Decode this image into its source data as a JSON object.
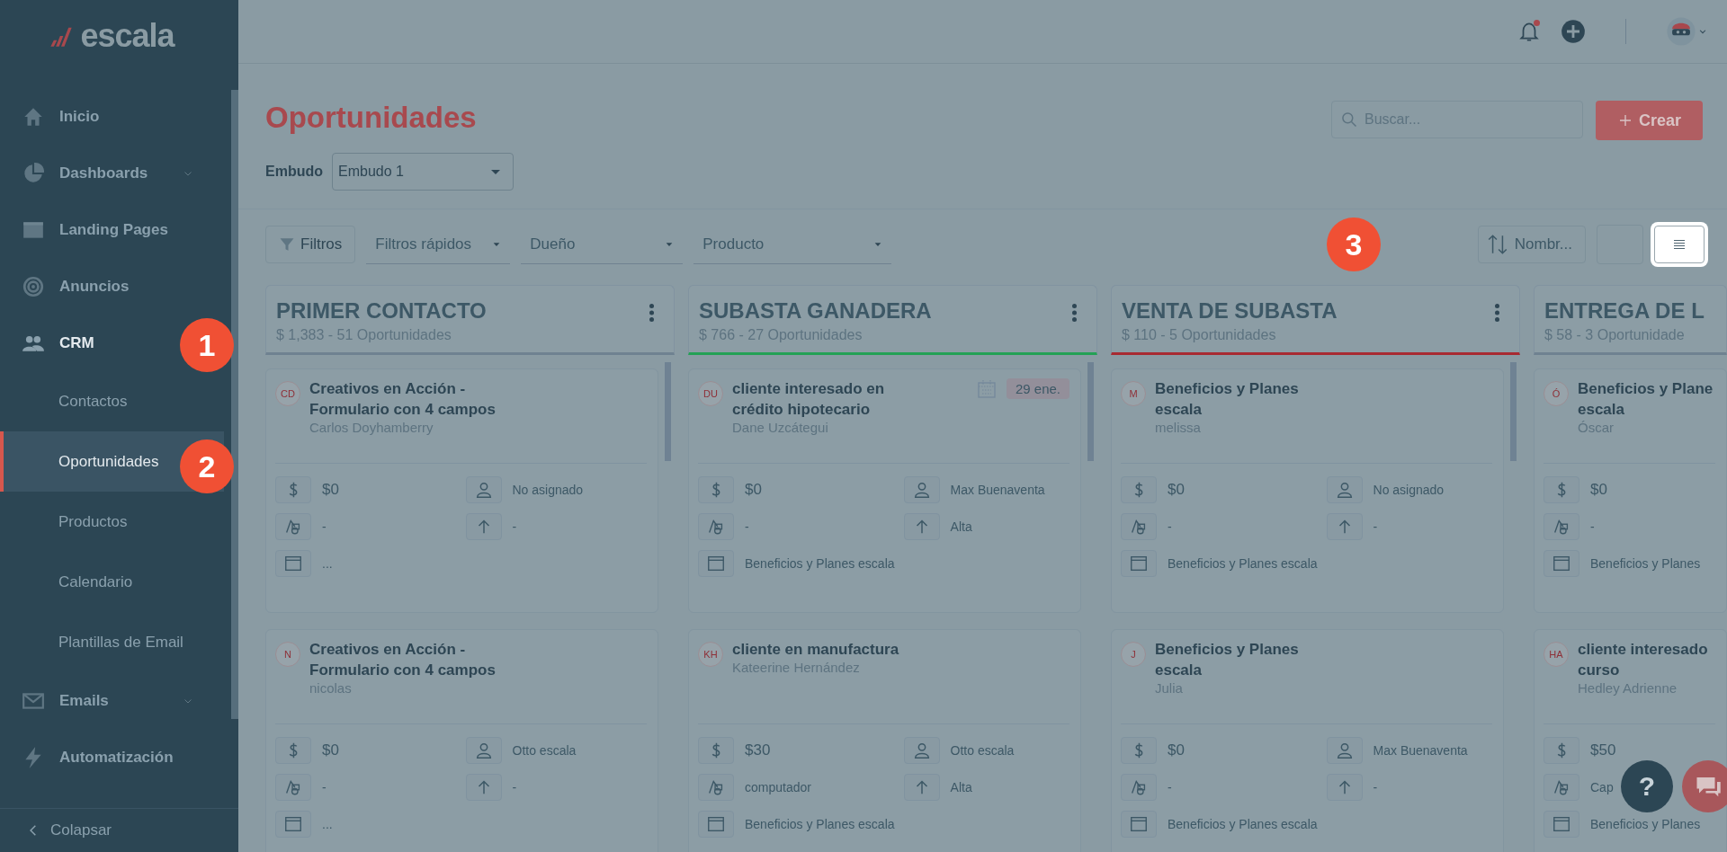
{
  "logo": {
    "text": "escala"
  },
  "sidebar": {
    "items": [
      {
        "label": "Inicio",
        "kind": "link",
        "selected": false
      },
      {
        "label": "Dashboards",
        "kind": "group",
        "expanded": false,
        "selected": false
      },
      {
        "label": "Landing Pages",
        "kind": "link",
        "selected": false
      },
      {
        "label": "Anuncios",
        "kind": "link",
        "selected": false
      },
      {
        "label": "CRM",
        "kind": "group",
        "expanded": true,
        "selected": false,
        "children": [
          {
            "label": "Contactos",
            "selected": false
          },
          {
            "label": "Oportunidades",
            "selected": true
          },
          {
            "label": "Productos",
            "selected": false
          },
          {
            "label": "Calendario",
            "selected": false
          },
          {
            "label": "Plantillas de Email",
            "selected": false
          }
        ]
      },
      {
        "label": "Emails",
        "kind": "group",
        "expanded": false,
        "selected": false
      },
      {
        "label": "Automatización",
        "kind": "link",
        "selected": false
      }
    ],
    "collapse": "Colapsar"
  },
  "header": {
    "notifications": true
  },
  "page": {
    "title": "Oportunidades",
    "search": {
      "placeholder": "Buscar..."
    },
    "create_button": "Crear",
    "pipeline": {
      "label": "Embudo",
      "value": "Embudo 1"
    },
    "filters": {
      "button": "Filtros",
      "dropdowns": [
        "Filtros rápidos",
        "Dueño",
        "Producto"
      ],
      "sort": "Nombr..."
    }
  },
  "columns": [
    {
      "title": "PRIMER CONTACTO",
      "summary": "$ 1,383 - 51 Oportunidades",
      "color": "#6f8291",
      "cards": [
        {
          "initials": "CD",
          "title": "Creativos en Acción -\nFormulario con 4 campos",
          "contact": "Carlos Doyhamberry",
          "fields": [
            {
              "kind": "amount",
              "value": "$0"
            },
            {
              "kind": "owner",
              "value": "No asignado"
            },
            {
              "kind": "product",
              "value": "-"
            },
            {
              "kind": "priority",
              "value": "-"
            },
            {
              "kind": "source",
              "value": "..."
            }
          ]
        },
        {
          "initials": "N",
          "title": "Creativos en Acción -\nFormulario con 4 campos",
          "contact": "nicolas",
          "fields": [
            {
              "kind": "amount",
              "value": "$0"
            },
            {
              "kind": "owner",
              "value": "Otto escala"
            },
            {
              "kind": "product",
              "value": "-"
            },
            {
              "kind": "priority",
              "value": "-"
            },
            {
              "kind": "source",
              "value": "..."
            }
          ]
        }
      ]
    },
    {
      "title": "SUBASTA GANADERA",
      "summary": "$ 766 - 27 Oportunidades",
      "color": "#24a155",
      "cards": [
        {
          "initials": "DU",
          "title": "cliente interesado en\ncrédito hipotecario",
          "contact": "Dane Uzcátegui",
          "date": "29 ene.",
          "fields": [
            {
              "kind": "amount",
              "value": "$0"
            },
            {
              "kind": "owner",
              "value": "Max Buenaventa"
            },
            {
              "kind": "product",
              "value": "-"
            },
            {
              "kind": "priority",
              "value": "Alta"
            },
            {
              "kind": "source",
              "value": "Beneficios y Planes escala"
            }
          ]
        },
        {
          "initials": "KH",
          "title": "cliente en manufactura",
          "contact": "Kateerine Hernández",
          "fields": [
            {
              "kind": "amount",
              "value": "$30"
            },
            {
              "kind": "owner",
              "value": "Otto escala"
            },
            {
              "kind": "product",
              "value": "computador"
            },
            {
              "kind": "priority",
              "value": "Alta"
            },
            {
              "kind": "source",
              "value": "Beneficios y Planes escala"
            }
          ]
        }
      ]
    },
    {
      "title": "VENTA DE SUBASTA",
      "summary": "$ 110 - 5 Oportunidades",
      "color": "#a82a31",
      "cards": [
        {
          "initials": "M",
          "title": "Beneficios y Planes\nescala",
          "contact": "melissa",
          "fields": [
            {
              "kind": "amount",
              "value": "$0"
            },
            {
              "kind": "owner",
              "value": "No asignado"
            },
            {
              "kind": "product",
              "value": "-"
            },
            {
              "kind": "priority",
              "value": "-"
            },
            {
              "kind": "source",
              "value": "Beneficios y Planes escala"
            }
          ]
        },
        {
          "initials": "J",
          "title": "Beneficios y Planes\nescala",
          "contact": "Julia",
          "fields": [
            {
              "kind": "amount",
              "value": "$0"
            },
            {
              "kind": "owner",
              "value": "Max Buenaventa"
            },
            {
              "kind": "product",
              "value": "-"
            },
            {
              "kind": "priority",
              "value": "-"
            },
            {
              "kind": "source",
              "value": "Beneficios y Planes escala"
            }
          ]
        }
      ]
    },
    {
      "title": "ENTREGA DE L",
      "summary": "$ 58 - 3 Oportunidade",
      "color": "#6f8291",
      "cards": [
        {
          "initials": "Ó",
          "title": "Beneficios y Plane\nescala",
          "contact": "Óscar",
          "fields": [
            {
              "kind": "amount",
              "value": "$0"
            },
            {
              "kind": "product",
              "value": "-"
            },
            {
              "kind": "source",
              "value": "Beneficios y Planes"
            }
          ]
        },
        {
          "initials": "HA",
          "title": "cliente interesado\ncurso",
          "contact": "Hedley Adrienne",
          "fields": [
            {
              "kind": "amount",
              "value": "$50"
            },
            {
              "kind": "product",
              "value": "Cap"
            },
            {
              "kind": "source",
              "value": "Beneficios y Planes"
            }
          ]
        }
      ]
    }
  ],
  "help_button": "?",
  "markers": [
    "1",
    "2",
    "3"
  ]
}
